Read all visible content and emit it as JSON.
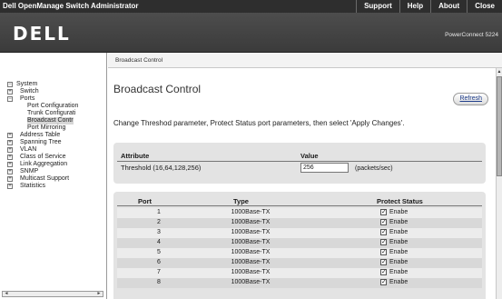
{
  "titlebar": {
    "app_title": "Dell OpenManage Switch Administrator",
    "nav": [
      "Support",
      "Help",
      "About",
      "Close"
    ]
  },
  "brand": {
    "logo": "DELL",
    "model": "PowerConnect 5224"
  },
  "tree": [
    {
      "label": "System",
      "expander": "−",
      "level": 0
    },
    {
      "label": "Switch",
      "expander": "+",
      "level": 1
    },
    {
      "label": "Ports",
      "expander": "−",
      "level": 1
    },
    {
      "label": "Port Configuration",
      "expander": "",
      "level": 2
    },
    {
      "label": "Trunk Configurati",
      "expander": "",
      "level": 2
    },
    {
      "label": "Broadcast Contr",
      "expander": "",
      "level": 2,
      "selected": true
    },
    {
      "label": "Port Mirroring",
      "expander": "",
      "level": 2
    },
    {
      "label": "Address Table",
      "expander": "+",
      "level": 1
    },
    {
      "label": "Spanning Tree",
      "expander": "+",
      "level": 1
    },
    {
      "label": "VLAN",
      "expander": "+",
      "level": 1
    },
    {
      "label": "Class of Service",
      "expander": "+",
      "level": 1
    },
    {
      "label": "Link Aggregation",
      "expander": "+",
      "level": 1
    },
    {
      "label": "SNMP",
      "expander": "+",
      "level": 1
    },
    {
      "label": "Multicast Support",
      "expander": "+",
      "level": 1
    },
    {
      "label": "Statistics",
      "expander": "+",
      "level": 1
    }
  ],
  "breadcrumb": "Broadcast Control",
  "page": {
    "title": "Broadcast Control",
    "refresh_label": "Refresh",
    "instructions": "Change Threshod parameter, Protect Status port parameters, then select 'Apply Changes'."
  },
  "attributes": {
    "header_attribute": "Attribute",
    "header_value": "Value",
    "threshold_label": "Threshold (16,64,128,256)",
    "threshold_value": "256",
    "threshold_unit": "(packets/sec)"
  },
  "ports": {
    "header_port": "Port",
    "header_type": "Type",
    "header_protect": "Protect Status",
    "rows": [
      {
        "port": "1",
        "type": "1000Base-TX",
        "protect": "Enabe",
        "checked": true
      },
      {
        "port": "2",
        "type": "1000Base-TX",
        "protect": "Enabe",
        "checked": true
      },
      {
        "port": "3",
        "type": "1000Base-TX",
        "protect": "Enabe",
        "checked": true
      },
      {
        "port": "4",
        "type": "1000Base-TX",
        "protect": "Enabe",
        "checked": true
      },
      {
        "port": "5",
        "type": "1000Base-TX",
        "protect": "Enabe",
        "checked": true
      },
      {
        "port": "6",
        "type": "1000Base-TX",
        "protect": "Enabe",
        "checked": true
      },
      {
        "port": "7",
        "type": "1000Base-TX",
        "protect": "Enabe",
        "checked": true
      },
      {
        "port": "8",
        "type": "1000Base-TX",
        "protect": "Enabe",
        "checked": true
      }
    ]
  },
  "colors": {
    "titlebar_bg": "#2e2e2e",
    "brand_bg": "#444444",
    "table_bg": "#e3e3e3",
    "link": "#1e3c8a"
  }
}
